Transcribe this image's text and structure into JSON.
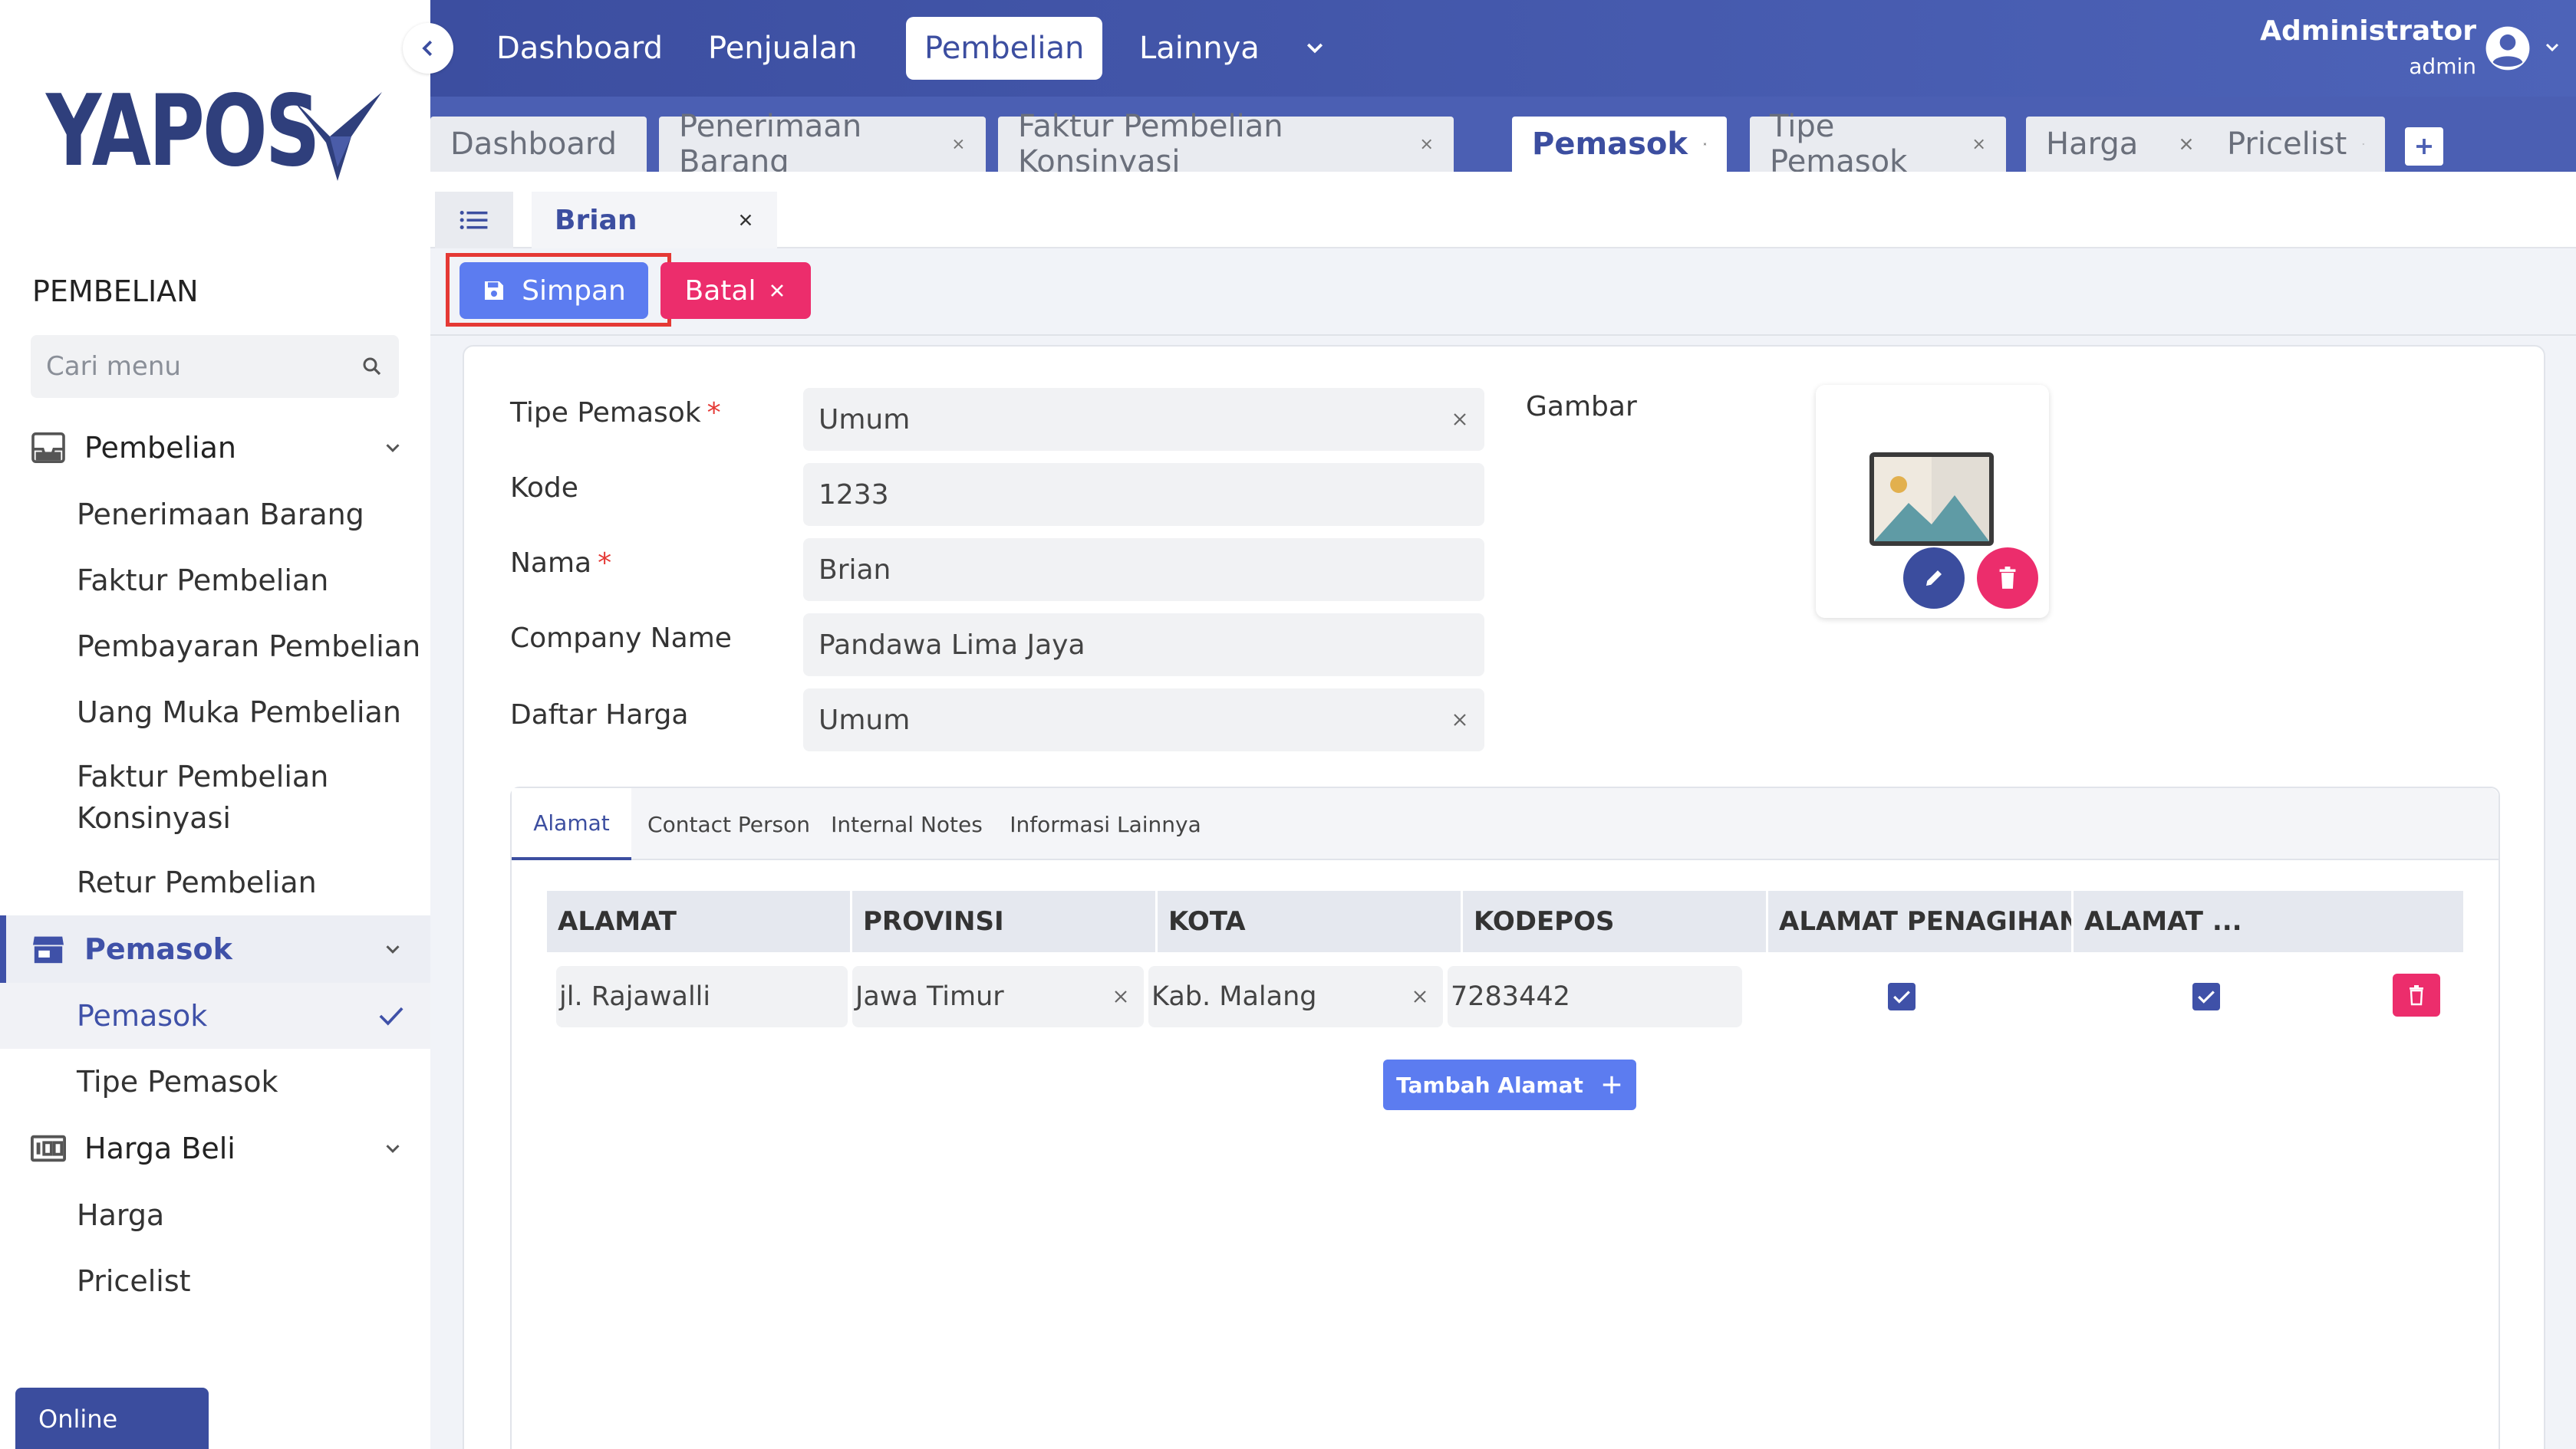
{
  "brand": {
    "logo_text": "YAPOS"
  },
  "sidebar": {
    "section_title": "PEMBELIAN",
    "search_placeholder": "Cari menu",
    "groups": [
      {
        "label": "Pembelian",
        "icon": "inbox-icon",
        "items": [
          "Penerimaan Barang",
          "Faktur Pembelian",
          "Pembayaran Pembelian",
          "Uang Muka Pembelian",
          "Faktur Pembelian Konsinyasi",
          "Retur Pembelian"
        ]
      },
      {
        "label": "Pemasok",
        "icon": "store-icon",
        "active": true,
        "items": [
          "Pemasok",
          "Tipe Pemasok"
        ],
        "active_item": "Pemasok"
      },
      {
        "label": "Harga Beli",
        "icon": "price-tag-icon",
        "items": [
          "Harga",
          "Pricelist"
        ]
      }
    ],
    "status": "Online"
  },
  "topnav": {
    "items": [
      "Dashboard",
      "Penjualan",
      "Pembelian",
      "Lainnya"
    ],
    "active": "Pembelian",
    "user_name": "Administrator",
    "user_role": "admin"
  },
  "window_tabs": [
    "Dashboard",
    "Penerimaan Barang",
    "Faktur Pembelian Konsinyasi",
    "Pemasok",
    "Tipe Pemasok",
    "Harga",
    "Pricelist"
  ],
  "window_tab_active": "Pemasok",
  "subtab": {
    "record": "Brian"
  },
  "actions": {
    "save": "Simpan",
    "cancel": "Batal"
  },
  "form": {
    "tipe_pemasok": {
      "label": "Tipe Pemasok",
      "value": "Umum",
      "required": true
    },
    "kode": {
      "label": "Kode",
      "value": "1233"
    },
    "nama": {
      "label": "Nama",
      "value": "Brian",
      "required": true
    },
    "company_name": {
      "label": "Company Name",
      "value": "Pandawa Lima Jaya"
    },
    "daftar_harga": {
      "label": "Daftar Harga",
      "value": "Umum"
    },
    "gambar_label": "Gambar",
    "required_mark": "*"
  },
  "panel": {
    "tabs": [
      "Alamat",
      "Contact Person",
      "Internal Notes",
      "Informasi Lainnya"
    ],
    "active_tab": "Alamat",
    "columns": [
      "ALAMAT",
      "PROVINSI",
      "KOTA",
      "KODEPOS",
      "ALAMAT PENAGIHAN",
      "ALAMAT ..."
    ],
    "rows": [
      {
        "alamat": "jl. Rajawalli",
        "provinsi": "Jawa Timur",
        "kota": "Kab. Malang",
        "kodepos": "7283442",
        "alamat_penagihan": true,
        "alamat_lain": true
      }
    ],
    "add_button": "Tambah Alamat"
  },
  "colors": {
    "primary": "#3c4ea0",
    "accent": "#5c7cf0",
    "danger": "#ec2d6c",
    "highlight": "#e53935"
  }
}
